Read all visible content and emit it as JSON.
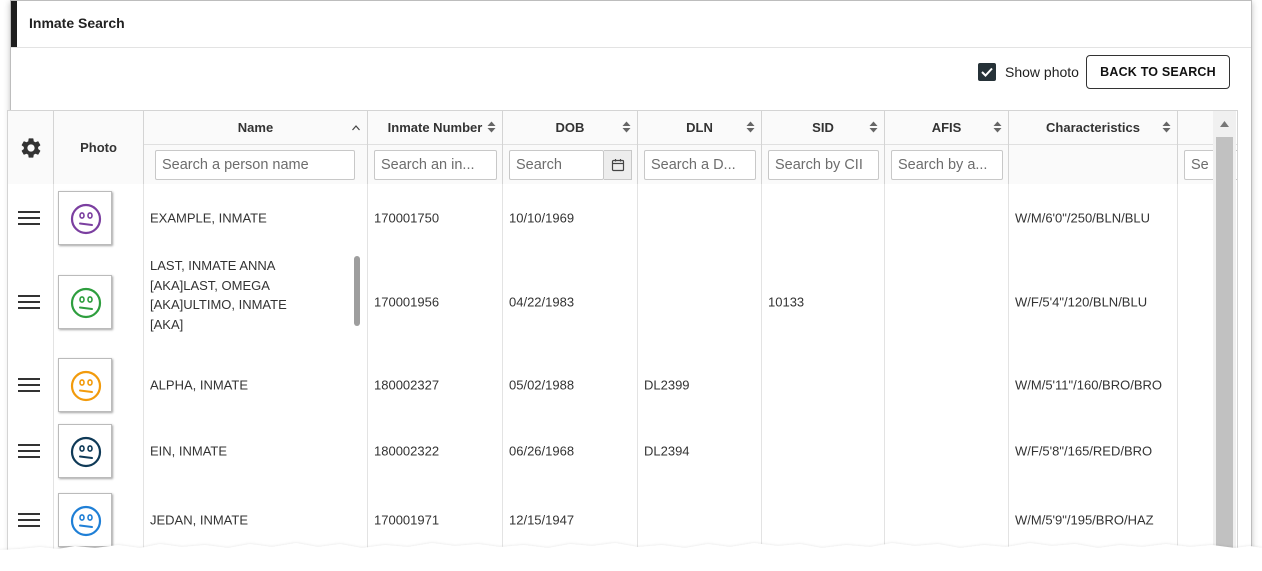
{
  "panel": {
    "title": "Inmate Search"
  },
  "toolbar": {
    "show_photo_label": "Show photo",
    "show_photo_checked": true,
    "back_label": "BACK TO SEARCH"
  },
  "grid": {
    "photo_header": "Photo",
    "columns": [
      {
        "key": "name",
        "label": "Name",
        "placeholder": "Search a person name",
        "sort": "asc"
      },
      {
        "key": "inmate_number",
        "label": "Inmate Number",
        "placeholder": "Search an in...",
        "sort": "none"
      },
      {
        "key": "dob",
        "label": "DOB",
        "placeholder": "Search",
        "sort": "none"
      },
      {
        "key": "dln",
        "label": "DLN",
        "placeholder": "Search a D...",
        "sort": "none"
      },
      {
        "key": "sid",
        "label": "SID",
        "placeholder": "Search by CII",
        "sort": "none"
      },
      {
        "key": "afis",
        "label": "AFIS",
        "placeholder": "Search by a...",
        "sort": "none"
      },
      {
        "key": "characteristics",
        "label": "Characteristics",
        "placeholder": "",
        "sort": "none"
      },
      {
        "key": "extra",
        "label": "",
        "placeholder": "Se",
        "sort": "none"
      }
    ],
    "rows": [
      {
        "avatar_color": "#7b3fa0",
        "name": "EXAMPLE, INMATE",
        "inmate_number": "170001750",
        "dob": "10/10/1969",
        "dln": "",
        "sid": "",
        "afis": "",
        "characteristics": "W/M/6'0\"/250/BLN/BLU"
      },
      {
        "avatar_color": "#2e9e3e",
        "name_lines": [
          "LAST, INMATE ANNA",
          "[AKA]LAST, OMEGA",
          "[AKA]ULTIMO, INMATE",
          "[AKA]"
        ],
        "inmate_number": "170001956",
        "dob": "04/22/1983",
        "dln": "",
        "sid": "10133",
        "afis": "",
        "characteristics": "W/F/5'4\"/120/BLN/BLU"
      },
      {
        "avatar_color": "#f29b0c",
        "name": "ALPHA, INMATE",
        "inmate_number": "180002327",
        "dob": "05/02/1988",
        "dln": "DL2399",
        "sid": "",
        "afis": "",
        "characteristics": "W/M/5'11\"/160/BRO/BRO"
      },
      {
        "avatar_color": "#0f3a57",
        "name": "EIN, INMATE",
        "inmate_number": "180002322",
        "dob": "06/26/1968",
        "dln": "DL2394",
        "sid": "",
        "afis": "",
        "characteristics": "W/F/5'8\"/165/RED/BRO"
      },
      {
        "avatar_color": "#1f7fd6",
        "name": "JEDAN, INMATE",
        "inmate_number": "170001971",
        "dob": "12/15/1947",
        "dln": "",
        "sid": "",
        "afis": "",
        "characteristics": "W/M/5'9\"/195/BRO/HAZ"
      }
    ]
  }
}
